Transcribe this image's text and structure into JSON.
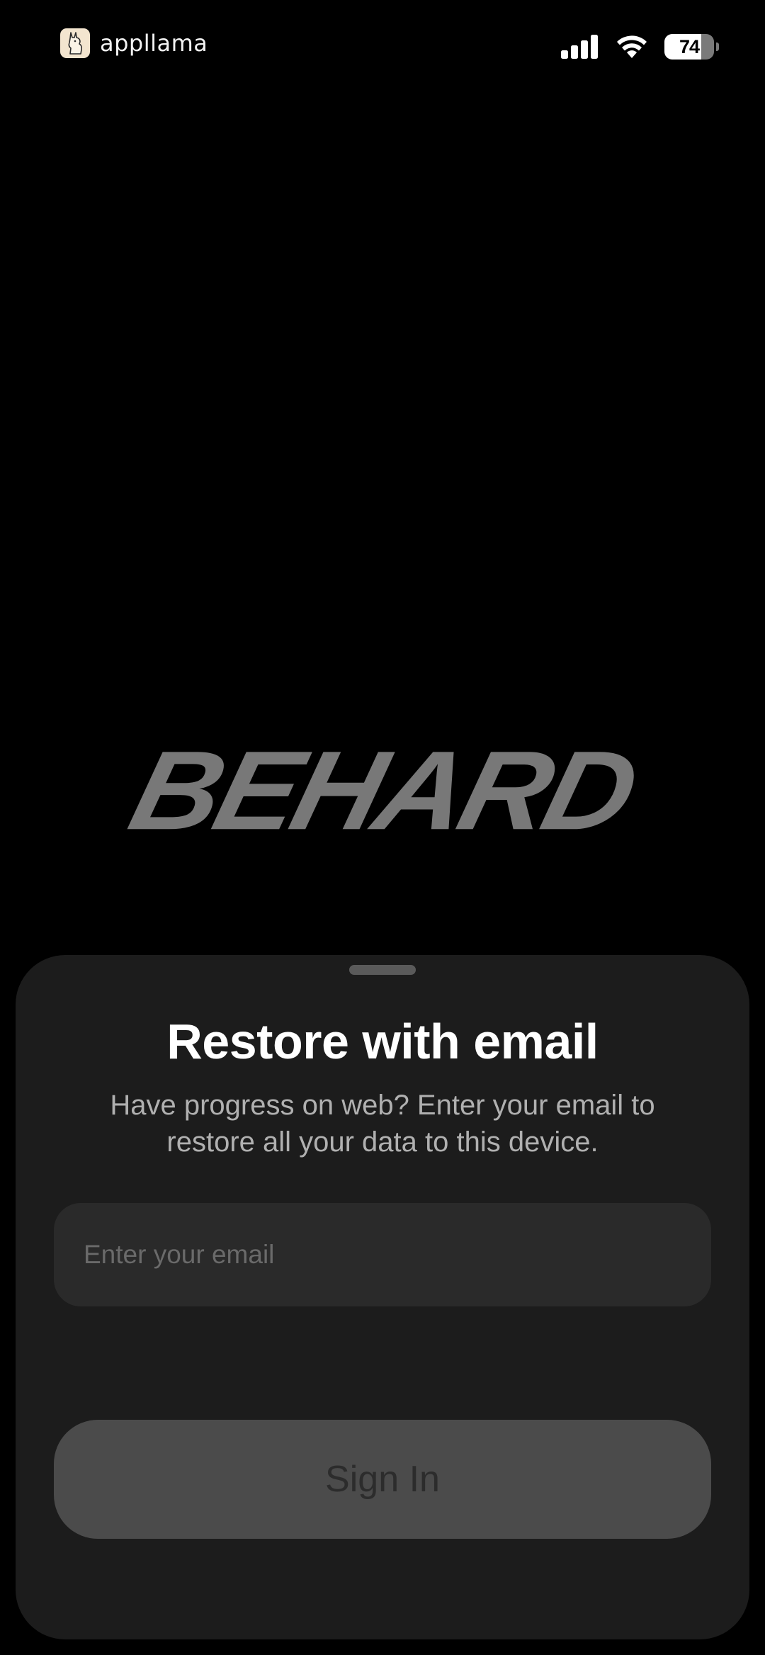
{
  "status_bar": {
    "brand_name": "appllama",
    "brand_icon": "llama-logo-icon",
    "cellular_icon": "cellular-signal-icon",
    "wifi_icon": "wifi-icon",
    "battery_level": "74"
  },
  "hero": {
    "logo_text": "BEHARD"
  },
  "sheet": {
    "title": "Restore with email",
    "subtitle": "Have progress on web? Enter your email to restore all your data to this device.",
    "email": {
      "placeholder": "Enter your email",
      "value": ""
    },
    "sign_in_label": "Sign In"
  },
  "colors": {
    "background": "#000000",
    "sheet": "#1c1c1c",
    "field": "#2a2a2a",
    "button_disabled": "#4b4b4b",
    "logo": "#787878"
  }
}
